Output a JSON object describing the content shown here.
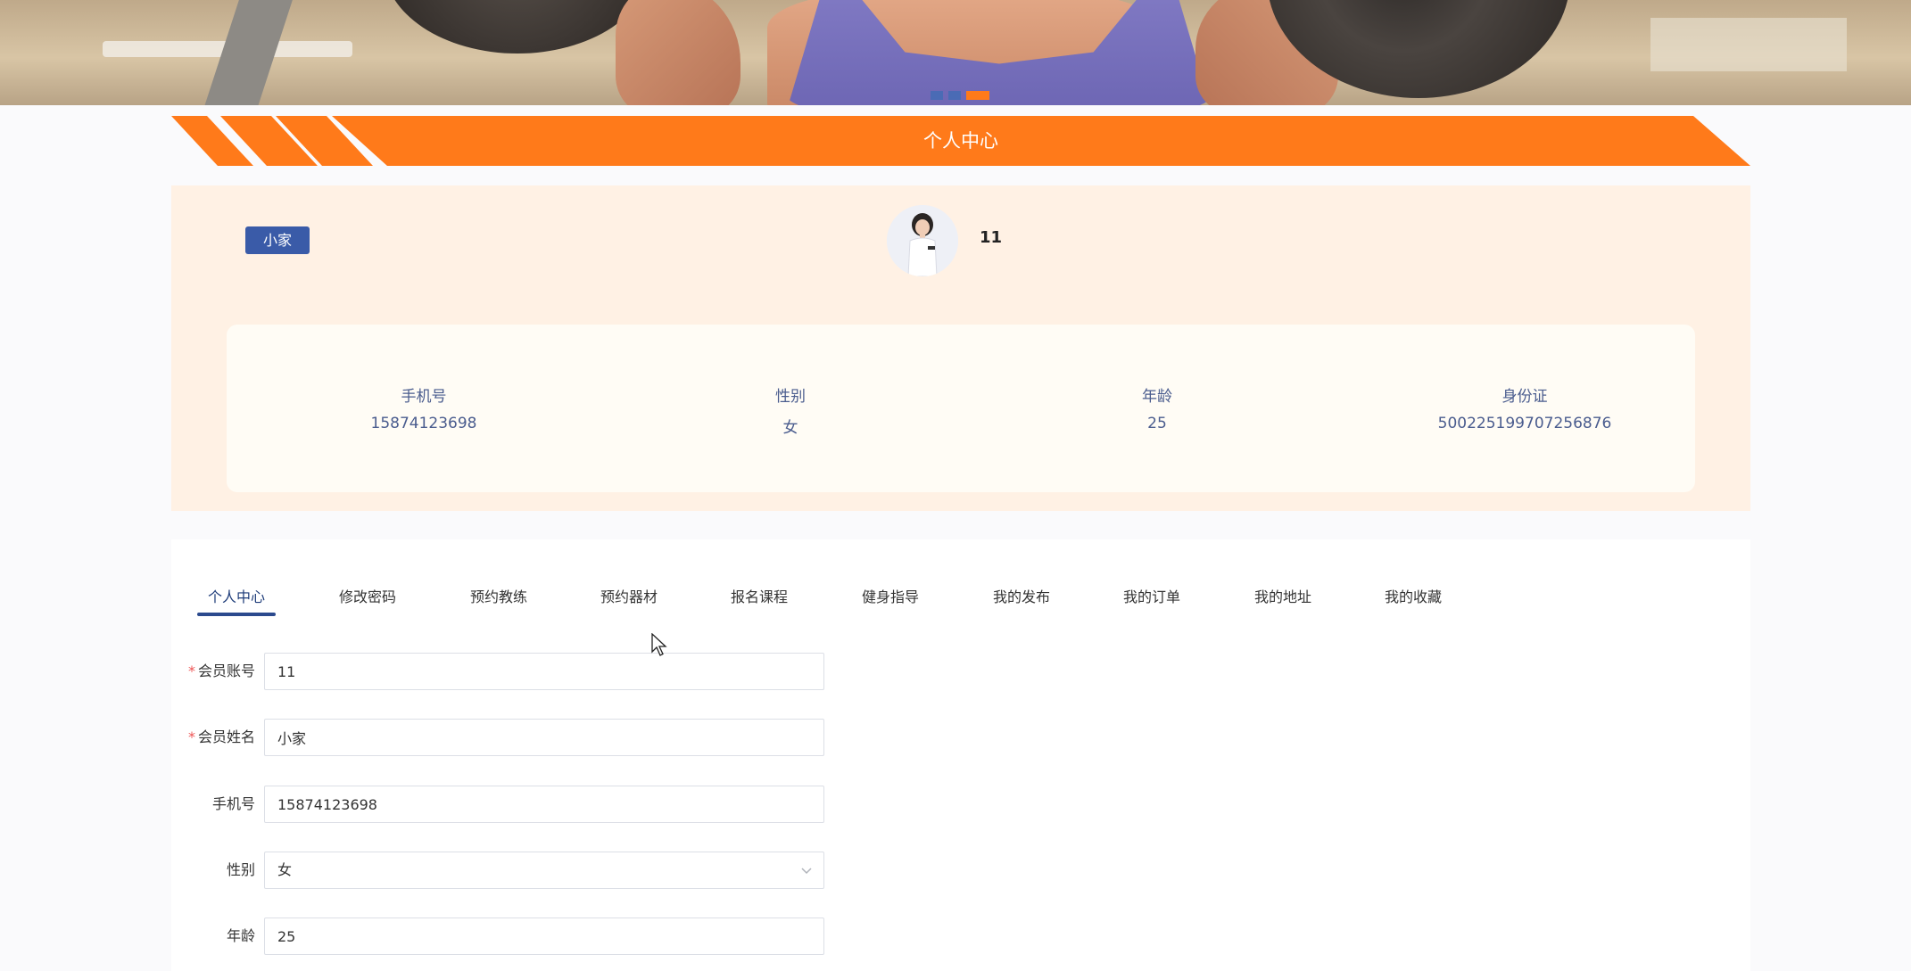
{
  "page": {
    "section_title": "个人中心"
  },
  "colors": {
    "brand_orange": "#ff7a1a",
    "brand_blue": "#3a5ba8",
    "card_bg": "#fff1e4"
  },
  "banner": {
    "slide_count": 3,
    "active_slide": 3
  },
  "profile": {
    "name_badge": "小家",
    "account": "11",
    "fields": [
      {
        "label": "手机号",
        "value": "15874123698"
      },
      {
        "label": "性别",
        "value": "女"
      },
      {
        "label": "年龄",
        "value": "25"
      },
      {
        "label": "身份证",
        "value": "500225199707256876"
      }
    ]
  },
  "tabs": [
    {
      "label": "个人中心",
      "active": true
    },
    {
      "label": "修改密码",
      "active": false
    },
    {
      "label": "预约教练",
      "active": false
    },
    {
      "label": "预约器材",
      "active": false
    },
    {
      "label": "报名课程",
      "active": false
    },
    {
      "label": "健身指导",
      "active": false
    },
    {
      "label": "我的发布",
      "active": false
    },
    {
      "label": "我的订单",
      "active": false
    },
    {
      "label": "我的地址",
      "active": false
    },
    {
      "label": "我的收藏",
      "active": false
    }
  ],
  "form": {
    "account": {
      "label": "会员账号",
      "required_mark": "*",
      "value": "11"
    },
    "name": {
      "label": "会员姓名",
      "required_mark": "*",
      "value": "小家"
    },
    "phone": {
      "label": "手机号",
      "value": "15874123698"
    },
    "gender": {
      "label": "性别",
      "value": "女",
      "icon": "chevron-down-icon"
    },
    "age": {
      "label": "年龄",
      "value": "25"
    }
  }
}
